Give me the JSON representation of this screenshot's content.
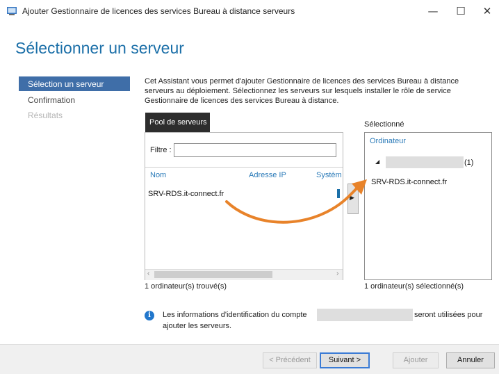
{
  "window": {
    "title": "Ajouter Gestionnaire de licences des services Bureau à distance serveurs",
    "minimize": "—",
    "maximize": "☐",
    "close": "✕"
  },
  "page": {
    "heading": "Sélectionner un serveur",
    "description": "Cet Assistant vous permet d'ajouter Gestionnaire de licences des services Bureau à distance serveurs au déploiement. Sélectionnez les serveurs sur lesquels installer le rôle de service Gestionnaire de licences des services Bureau à distance."
  },
  "nav": {
    "items": [
      {
        "label": "Sélection un serveur",
        "state": "active"
      },
      {
        "label": "Confirmation",
        "state": "normal"
      },
      {
        "label": "Résultats",
        "state": "disabled"
      }
    ]
  },
  "pool": {
    "tab_label": "Pool de serveurs",
    "filter_label": "Filtre :",
    "filter_value": "",
    "columns": [
      "Nom",
      "Adresse IP",
      "Systèm"
    ],
    "rows": [
      {
        "name": "SRV-RDS.it-connect.fr"
      }
    ],
    "footer": "1 ordinateur(s) trouvé(s)",
    "scroll_left": "‹",
    "scroll_right": "›"
  },
  "add_arrow": "▶",
  "selected": {
    "label": "Sélectionné",
    "column": "Ordinateur",
    "group_suffix": "(1)",
    "tree_arrow": "◢",
    "rows": [
      {
        "name": "SRV-RDS.it-connect.fr"
      }
    ],
    "footer": "1 ordinateur(s) sélectionné(s)"
  },
  "info": {
    "icon": "i",
    "text_before": "Les informations d'identification du compte",
    "text_after": "seront utilisées pour",
    "text_line2": "ajouter les serveurs."
  },
  "buttons": {
    "previous": "< Précédent",
    "next": "Suivant >",
    "add": "Ajouter",
    "cancel": "Annuler"
  },
  "colors": {
    "accent": "#1b6fa8",
    "nav_active_bg": "#3f6ea8",
    "annotation_arrow": "#e8832a"
  }
}
